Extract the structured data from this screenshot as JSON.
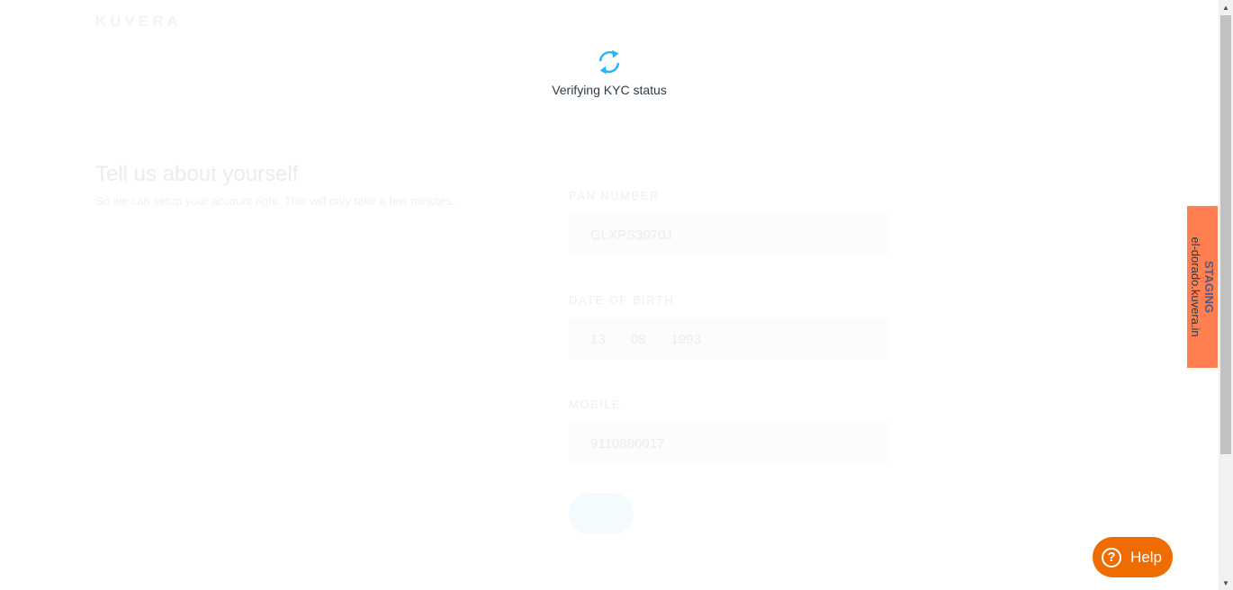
{
  "brand": {
    "logo_text": "KUVERA"
  },
  "loader": {
    "icon": "sync-icon",
    "text": "Verifying KYC status",
    "accent": "#29b6f6"
  },
  "intro": {
    "title": "Tell us about yourself",
    "subtitle": "So we can setup your account right. This will only take a few minutes."
  },
  "form": {
    "pan": {
      "label": "PAN NUMBER",
      "value": "GLXPS3070J"
    },
    "dob": {
      "label": "DATE OF BIRTH",
      "day": "13",
      "month": "08",
      "year": "1993"
    },
    "mobile": {
      "label": "MOBILE",
      "value": "9110880017"
    },
    "next_label": "Next"
  },
  "staging": {
    "title": "STAGING",
    "host": "el-dorado.kuvera.in",
    "color": "#ff7f50"
  },
  "help": {
    "label": "Help",
    "icon": "question-circle-icon",
    "color": "#ef6c00"
  }
}
